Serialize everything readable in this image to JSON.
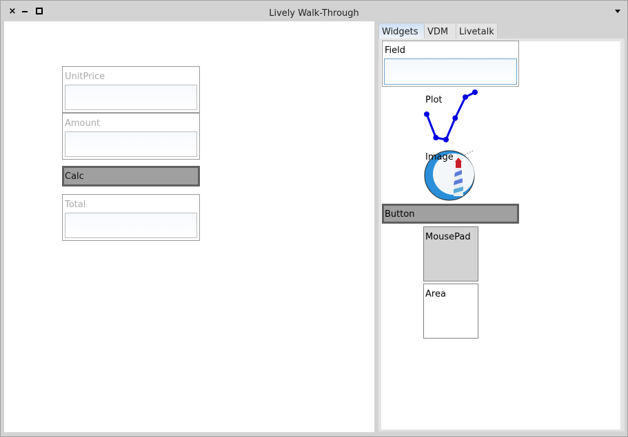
{
  "window": {
    "title": "Lively Walk-Through",
    "controls": {
      "close": "×",
      "minimize": "minimize",
      "maximize": "maximize",
      "menu": "menu"
    }
  },
  "world": {
    "fields": [
      {
        "label": "UnitPrice",
        "value": ""
      },
      {
        "label": "Amount",
        "value": ""
      },
      {
        "label": "Total",
        "value": ""
      }
    ],
    "calc_button": "Calc"
  },
  "parts_bin": {
    "tabs": [
      {
        "label": "Widgets",
        "active": true
      },
      {
        "label": "VDM",
        "active": false
      },
      {
        "label": "Livetalk",
        "active": false
      }
    ],
    "items": {
      "field": "Field",
      "plot": "Plot",
      "image": "Image",
      "button": "Button",
      "mousepad": "MousePad",
      "area": "Area"
    },
    "plot_points": [
      [
        0,
        0.55
      ],
      [
        0.19,
        0.07
      ],
      [
        0.4,
        0.03
      ],
      [
        0.59,
        0.47
      ],
      [
        0.8,
        0.9
      ],
      [
        1.0,
        1.0
      ]
    ],
    "plot_color": "#0000e0"
  }
}
